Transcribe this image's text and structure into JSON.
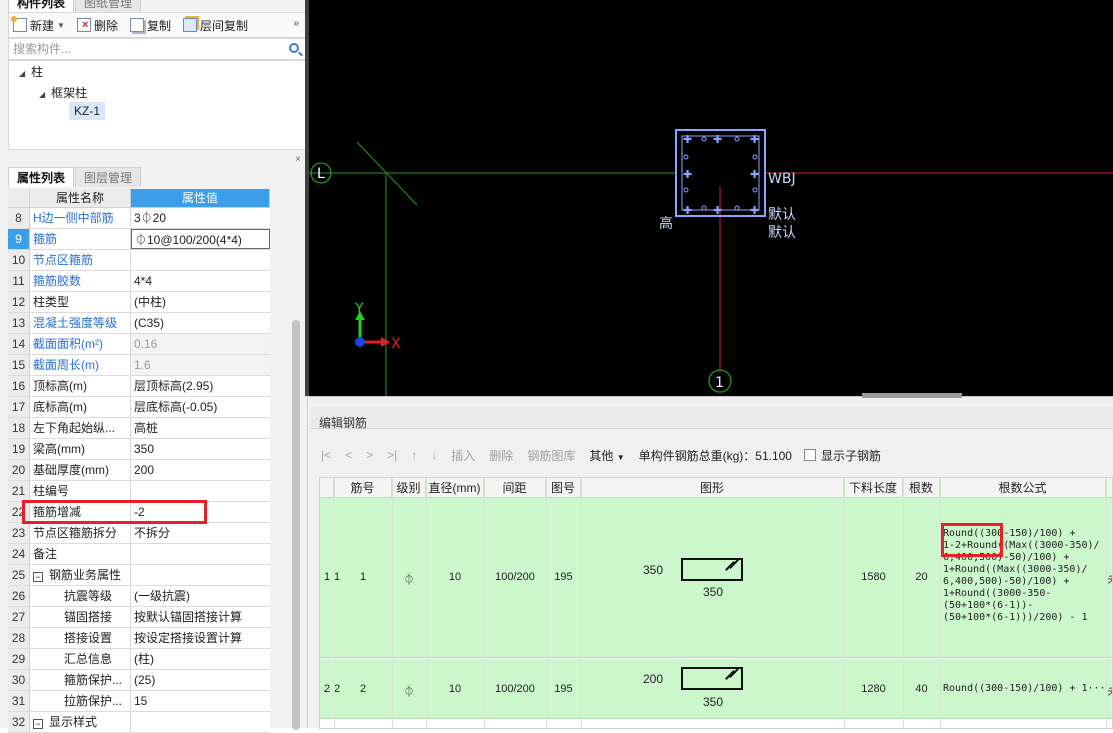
{
  "left_panel": {
    "top_tabs": [
      "构件列表",
      "图纸管理"
    ],
    "toolbar": {
      "new_label": "新建",
      "delete_label": "删除",
      "copy_label": "复制",
      "layer_copy_label": "层间复制",
      "more_glyph": "»"
    },
    "search_placeholder": "搜索构件...",
    "tree": {
      "root": "柱",
      "child": "框架柱",
      "leaf": "KZ-1"
    },
    "close_glyph": "×",
    "prop_tabs": [
      "属性列表",
      "图层管理"
    ],
    "prop_header": {
      "name": "属性名称",
      "value": "属性值"
    },
    "properties": [
      {
        "num": "8",
        "name": "H边一侧中部筋",
        "value": "3⏀20",
        "style": "blue"
      },
      {
        "num": "9",
        "name": "箍筋",
        "value": "⏀10@100/200(4*4)",
        "style": "blue-sel"
      },
      {
        "num": "10",
        "name": "节点区箍筋",
        "value": "",
        "style": "blue"
      },
      {
        "num": "11",
        "name": "箍筋胶数",
        "value": "4*4",
        "style": "blue"
      },
      {
        "num": "12",
        "name": "柱类型",
        "value": "(中柱)",
        "style": ""
      },
      {
        "num": "13",
        "name": "混凝土强度等级",
        "value": "(C35)",
        "style": "blue"
      },
      {
        "num": "14",
        "name": "截面面积(m²)",
        "value": "0.16",
        "style": "blue-gray"
      },
      {
        "num": "15",
        "name": "截面周长(m)",
        "value": "1.6",
        "style": "blue-gray"
      },
      {
        "num": "16",
        "name": "顶标高(m)",
        "value": "层顶标高(2.95)",
        "style": ""
      },
      {
        "num": "17",
        "name": "底标高(m)",
        "value": "层底标高(-0.05)",
        "style": ""
      },
      {
        "num": "18",
        "name": "左下角起始纵...",
        "value": "高桩",
        "style": ""
      },
      {
        "num": "19",
        "name": "梁高(mm)",
        "value": "350",
        "style": ""
      },
      {
        "num": "20",
        "name": "基础厚度(mm)",
        "value": "200",
        "style": ""
      },
      {
        "num": "21",
        "name": "柱编号",
        "value": "",
        "style": ""
      },
      {
        "num": "22",
        "name": "箍筋增减",
        "value": "-2",
        "style": ""
      },
      {
        "num": "23",
        "name": "节点区箍筋拆分",
        "value": "不拆分",
        "style": ""
      },
      {
        "num": "24",
        "name": "备注",
        "value": "",
        "style": ""
      },
      {
        "num": "25",
        "name": "钢筋业务属性",
        "value": "",
        "style": "group-open"
      },
      {
        "num": "26",
        "name": "抗震等级",
        "value": "(一级抗震)",
        "style": "sub"
      },
      {
        "num": "27",
        "name": "锚固搭接",
        "value": "按默认锚固搭接计算",
        "style": "sub"
      },
      {
        "num": "28",
        "name": "搭接设置",
        "value": "按设定搭接设置计算",
        "style": "sub"
      },
      {
        "num": "29",
        "name": "汇总信息",
        "value": "(柱)",
        "style": "sub"
      },
      {
        "num": "30",
        "name": "箍筋保护...",
        "value": "(25)",
        "style": "sub"
      },
      {
        "num": "31",
        "name": "拉筋保护...",
        "value": "15",
        "style": "sub"
      },
      {
        "num": "32",
        "name": "显示样式",
        "value": "",
        "style": "group-open"
      }
    ]
  },
  "canvas": {
    "axis_left_label": "L",
    "axis_bottom_label": "1",
    "column_label": "WBJ",
    "default_label_1": "默认",
    "default_label_2": "默认",
    "height_label": "高",
    "y_axis": "Y",
    "x_axis": "X",
    "colors": {
      "background": "#000000",
      "grid_green": "#1f9e1f",
      "grid_red": "#d8202a",
      "column_outline": "#8aa4ff"
    }
  },
  "editor": {
    "title": "编辑钢筋",
    "nav": [
      "|<",
      "<",
      ">",
      ">|",
      "↑",
      "↓"
    ],
    "buttons": {
      "insert": "插入",
      "delete": "删除",
      "library": "钢筋图库",
      "other": "其他"
    },
    "total_weight_label": "单构件钢筋总重(kg)：51.100",
    "show_sub_label": "显示子钢筋",
    "columns": [
      "筋号",
      "级别",
      "直径(mm)",
      "间距",
      "图号",
      "图形",
      "下料长度",
      "根数",
      "根数公式"
    ],
    "rows": [
      {
        "index": "1",
        "index2": "1",
        "bar_no": "1",
        "grade": "⏀",
        "diameter": "10",
        "spacing": "100/200",
        "shape_no": "195",
        "shape_h": "350",
        "shape_w": "350",
        "length": "1580",
        "count": "20",
        "formula": "Round((300-150)/100) +\n1-2+Round((Max((3000-350)/\n6,400,500)-50)/100) +\n1+Round((Max((3000-350)/\n6,400,500)-50)/100) +\n1+Round((3000-350-\n(50+100*(6-1))-\n(50+100*(6-1)))/200) - 1",
        "tail": "未"
      },
      {
        "index": "2",
        "index2": "2",
        "bar_no": "2",
        "grade": "⏀",
        "diameter": "10",
        "spacing": "100/200",
        "shape_no": "195",
        "shape_h": "200",
        "shape_w": "350",
        "length": "1280",
        "count": "40",
        "formula": "Round((300-150)/100) + 1···",
        "tail": "未"
      }
    ]
  }
}
